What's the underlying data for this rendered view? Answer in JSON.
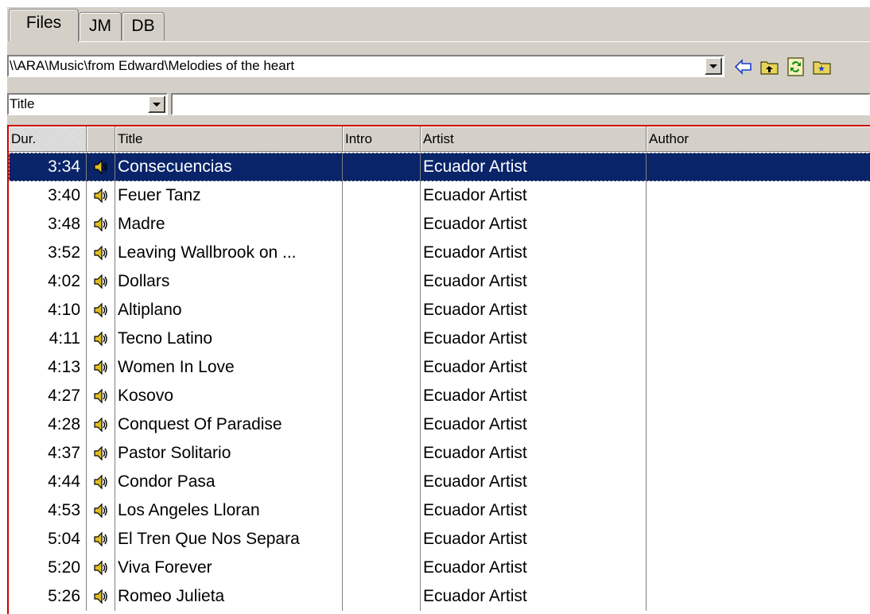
{
  "tabs": [
    {
      "label": "Files",
      "active": true
    },
    {
      "label": "JM",
      "active": false
    },
    {
      "label": "DB",
      "active": false
    }
  ],
  "path": {
    "value": "\\\\ARA\\Music\\from Edward\\Melodies of the heart"
  },
  "toolbar": {
    "icons": [
      "back-arrow-icon",
      "folder-up-icon",
      "refresh-icon",
      "new-folder-icon"
    ]
  },
  "filter": {
    "field_selected": "Title",
    "search_value": ""
  },
  "table": {
    "columns": [
      "Dur.",
      "",
      "Title",
      "Intro",
      "Artist",
      "Author"
    ],
    "sorted_column": "Dur.",
    "rows": [
      {
        "dur": "3:34",
        "title": "Consecuencias",
        "intro": "",
        "artist": "Ecuador Artist",
        "author": "",
        "selected": true
      },
      {
        "dur": "3:40",
        "title": "Feuer Tanz",
        "intro": "",
        "artist": "Ecuador Artist",
        "author": ""
      },
      {
        "dur": "3:48",
        "title": "Madre",
        "intro": "",
        "artist": "Ecuador Artist",
        "author": ""
      },
      {
        "dur": "3:52",
        "title": "Leaving Wallbrook on ...",
        "intro": "",
        "artist": "Ecuador Artist",
        "author": ""
      },
      {
        "dur": "4:02",
        "title": "Dollars",
        "intro": "",
        "artist": "Ecuador Artist",
        "author": ""
      },
      {
        "dur": "4:10",
        "title": "Altiplano",
        "intro": "",
        "artist": "Ecuador Artist",
        "author": ""
      },
      {
        "dur": "4:11",
        "title": "Tecno Latino",
        "intro": "",
        "artist": "Ecuador Artist",
        "author": ""
      },
      {
        "dur": "4:13",
        "title": "Women In Love",
        "intro": "",
        "artist": "Ecuador Artist",
        "author": ""
      },
      {
        "dur": "4:27",
        "title": "Kosovo",
        "intro": "",
        "artist": "Ecuador Artist",
        "author": ""
      },
      {
        "dur": "4:28",
        "title": "Conquest Of Paradise",
        "intro": "",
        "artist": "Ecuador Artist",
        "author": ""
      },
      {
        "dur": "4:37",
        "title": "Pastor Solitario",
        "intro": "",
        "artist": "Ecuador Artist",
        "author": ""
      },
      {
        "dur": "4:44",
        "title": "Condor Pasa",
        "intro": "",
        "artist": "Ecuador Artist",
        "author": ""
      },
      {
        "dur": "4:53",
        "title": "Los Angeles Lloran",
        "intro": "",
        "artist": "Ecuador Artist",
        "author": ""
      },
      {
        "dur": "5:04",
        "title": "El Tren Que Nos Separa",
        "intro": "",
        "artist": "Ecuador Artist",
        "author": ""
      },
      {
        "dur": "5:20",
        "title": "Viva Forever",
        "intro": "",
        "artist": "Ecuador Artist",
        "author": ""
      },
      {
        "dur": "5:26",
        "title": "Romeo Julieta",
        "intro": "",
        "artist": "Ecuador Artist",
        "author": ""
      }
    ]
  },
  "colors": {
    "selection": "#0a246a",
    "grid_border": "#d00000",
    "chrome": "#d4d0c8"
  }
}
